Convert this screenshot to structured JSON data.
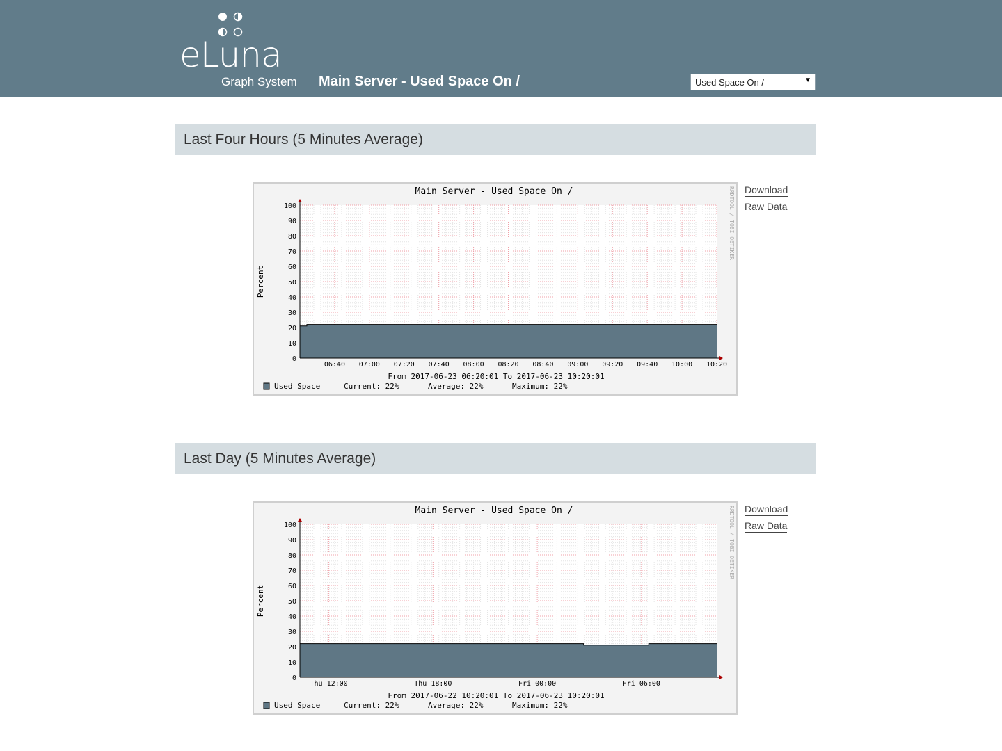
{
  "header": {
    "logo_word": "eLuna",
    "logo_sub": "Graph System",
    "page_title": "Main Server - Used Space On /",
    "select_value": "Used Space On /"
  },
  "graphs": [
    {
      "section_title": "Last Four Hours (5 Minutes Average)",
      "links": {
        "download": "Download",
        "raw": "Raw Data"
      },
      "chart_data": {
        "type": "area",
        "title": "Main Server - Used Space On /",
        "ylabel": "Percent",
        "ylim": [
          0,
          100
        ],
        "yticks": [
          0,
          10,
          20,
          30,
          40,
          50,
          60,
          70,
          80,
          90,
          100
        ],
        "xtick_labels": [
          "06:40",
          "07:00",
          "07:20",
          "07:40",
          "08:00",
          "08:20",
          "08:40",
          "09:00",
          "09:20",
          "09:40",
          "10:00",
          "10:20"
        ],
        "x_range_minutes": [
          0,
          240
        ],
        "xtick_minutes": [
          20,
          40,
          60,
          80,
          100,
          120,
          140,
          160,
          180,
          200,
          220,
          240
        ],
        "series": [
          {
            "name": "Used Space",
            "color": "#5f7785",
            "points": [
              [
                0,
                21
              ],
              [
                4,
                21
              ],
              [
                4,
                22
              ],
              [
                240,
                22
              ]
            ]
          }
        ],
        "range_text": "From 2017-06-23 06:20:01 To 2017-06-23 10:20:01",
        "legend": {
          "label": "Used Space",
          "current": "Current:   22%",
          "average": "Average:   22%",
          "maximum": "Maximum:   22%"
        },
        "watermark": "RRDTOOL / TOBI OETIKER"
      }
    },
    {
      "section_title": "Last Day (5 Minutes Average)",
      "links": {
        "download": "Download",
        "raw": "Raw Data"
      },
      "chart_data": {
        "type": "area",
        "title": "Main Server - Used Space On /",
        "ylabel": "Percent",
        "ylim": [
          0,
          100
        ],
        "yticks": [
          0,
          10,
          20,
          30,
          40,
          50,
          60,
          70,
          80,
          90,
          100
        ],
        "xtick_labels": [
          "Thu 12:00",
          "Thu 18:00",
          "Fri 00:00",
          "Fri 06:00"
        ],
        "x_range_minutes": [
          0,
          1440
        ],
        "xtick_minutes": [
          100,
          460,
          820,
          1180
        ],
        "series": [
          {
            "name": "Used Space",
            "color": "#5f7785",
            "points": [
              [
                0,
                22
              ],
              [
                980,
                22
              ],
              [
                980,
                21
              ],
              [
                1205,
                21
              ],
              [
                1205,
                22
              ],
              [
                1440,
                22
              ]
            ]
          }
        ],
        "range_text": "From 2017-06-22 10:20:01 To 2017-06-23 10:20:01",
        "legend": {
          "label": "Used Space",
          "current": "Current:   22%",
          "average": "Average:   22%",
          "maximum": "Maximum:   22%"
        },
        "watermark": "RRDTOOL / TOBI OETIKER"
      }
    }
  ]
}
